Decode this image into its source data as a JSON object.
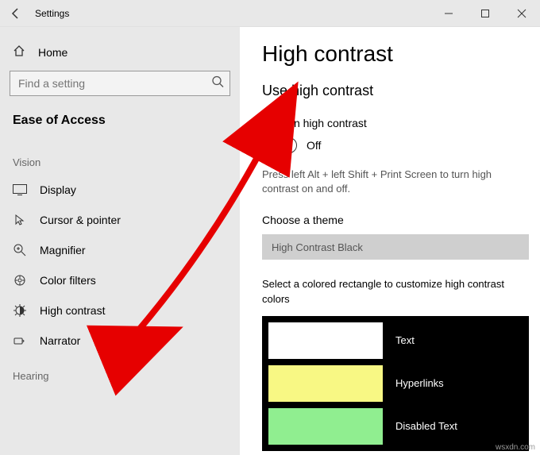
{
  "titlebar": {
    "title": "Settings"
  },
  "sidebar": {
    "home": "Home",
    "search_placeholder": "Find a setting",
    "section": "Ease of Access",
    "groups": [
      {
        "label": "Vision",
        "items": [
          {
            "icon": "display",
            "label": "Display"
          },
          {
            "icon": "cursor",
            "label": "Cursor & pointer"
          },
          {
            "icon": "magnifier",
            "label": "Magnifier"
          },
          {
            "icon": "colorfilters",
            "label": "Color filters"
          },
          {
            "icon": "highcontrast",
            "label": "High contrast"
          },
          {
            "icon": "narrator",
            "label": "Narrator"
          }
        ]
      },
      {
        "label": "Hearing",
        "items": []
      }
    ]
  },
  "content": {
    "page_title": "High contrast",
    "sub_title": "Use high contrast",
    "toggle_label": "Turn on high contrast",
    "toggle_state": "Off",
    "hint": "Press left Alt + left Shift + Print Screen to turn high contrast on and off.",
    "theme_label": "Choose a theme",
    "theme_value": "High Contrast Black",
    "customize_label": "Select a colored rectangle to customize high contrast colors",
    "swatches": [
      {
        "color": "#ffffff",
        "label": "Text"
      },
      {
        "color": "#f8f884",
        "label": "Hyperlinks"
      },
      {
        "color": "#90ee90",
        "label": "Disabled Text"
      }
    ]
  },
  "watermark": "wsxdn.com"
}
